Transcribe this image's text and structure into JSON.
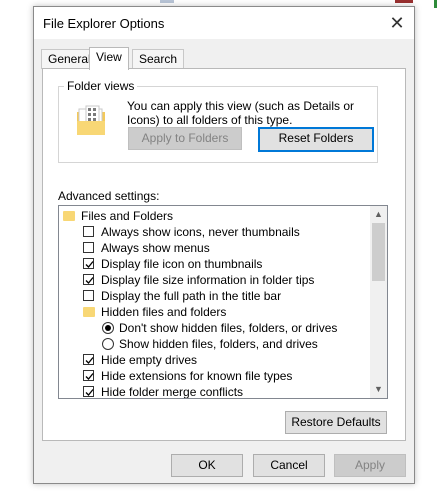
{
  "window": {
    "title": "File Explorer Options"
  },
  "tabs": [
    {
      "label": "General",
      "active": false
    },
    {
      "label": "View",
      "active": true
    },
    {
      "label": "Search",
      "active": false
    }
  ],
  "folder_views": {
    "label": "Folder views",
    "description": "You can apply this view (such as Details or Icons) to all folders of this type.",
    "apply_button": "Apply to Folders",
    "reset_button": "Reset Folders"
  },
  "advanced": {
    "label": "Advanced settings:",
    "items": [
      {
        "type": "folder",
        "label": "Files and Folders"
      },
      {
        "type": "checkbox",
        "label": "Always show icons, never thumbnails",
        "checked": false
      },
      {
        "type": "checkbox",
        "label": "Always show menus",
        "checked": false
      },
      {
        "type": "checkbox",
        "label": "Display file icon on thumbnails",
        "checked": true
      },
      {
        "type": "checkbox",
        "label": "Display file size information in folder tips",
        "checked": true
      },
      {
        "type": "checkbox",
        "label": "Display the full path in the title bar",
        "checked": false
      },
      {
        "type": "folder",
        "label": "Hidden files and folders"
      },
      {
        "type": "radio",
        "label": "Don't show hidden files, folders, or drives",
        "checked": true
      },
      {
        "type": "radio",
        "label": "Show hidden files, folders, and drives",
        "checked": false
      },
      {
        "type": "checkbox",
        "label": "Hide empty drives",
        "checked": true
      },
      {
        "type": "checkbox",
        "label": "Hide extensions for known file types",
        "checked": true
      },
      {
        "type": "checkbox",
        "label": "Hide folder merge conflicts",
        "checked": true
      }
    ]
  },
  "buttons": {
    "restore_defaults": "Restore Defaults",
    "ok": "OK",
    "cancel": "Cancel",
    "apply": "Apply"
  },
  "icons": {
    "close": "close-icon",
    "folder": "folder-icon",
    "folder_views": "folder-views-icon"
  },
  "colors": {
    "accent": "#0078d7",
    "folder": "#f8d775"
  }
}
